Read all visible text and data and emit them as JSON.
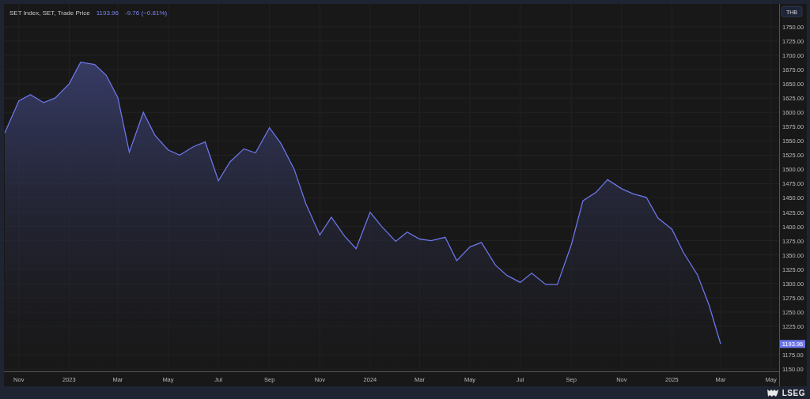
{
  "header": {
    "instrument": "SET Index, SET, Trade Price",
    "last": "1193.96",
    "change": "-9.76 (−0.81%)"
  },
  "price_axis": {
    "currency": "THB",
    "last_price_tag": "1193.96"
  },
  "chart_data": {
    "type": "area",
    "grid": true,
    "x": [
      "2022-10-15",
      "2022-11-01",
      "2022-11-15",
      "2022-12-01",
      "2022-12-15",
      "2023-01-01",
      "2023-01-15",
      "2023-02-01",
      "2023-02-15",
      "2023-03-01",
      "2023-03-15",
      "2023-04-01",
      "2023-04-15",
      "2023-05-01",
      "2023-05-15",
      "2023-06-01",
      "2023-06-15",
      "2023-07-01",
      "2023-07-15",
      "2023-08-01",
      "2023-08-15",
      "2023-09-01",
      "2023-09-15",
      "2023-10-01",
      "2023-10-15",
      "2023-11-01",
      "2023-11-15",
      "2023-12-01",
      "2023-12-15",
      "2024-01-01",
      "2024-01-15",
      "2024-02-01",
      "2024-02-15",
      "2024-03-01",
      "2024-03-15",
      "2024-04-01",
      "2024-04-15",
      "2024-05-01",
      "2024-05-15",
      "2024-06-01",
      "2024-06-15",
      "2024-07-01",
      "2024-07-15",
      "2024-08-01",
      "2024-08-15",
      "2024-09-01",
      "2024-09-15",
      "2024-10-01",
      "2024-10-15",
      "2024-11-01",
      "2024-11-15",
      "2024-12-01",
      "2024-12-15",
      "2025-01-01",
      "2025-01-15",
      "2025-02-01",
      "2025-02-15",
      "2025-03-01"
    ],
    "series": [
      {
        "color": "#6c75e8",
        "values": [
          1564,
          1620,
          1631,
          1617,
          1625,
          1650,
          1688,
          1684,
          1665,
          1626,
          1530,
          1600,
          1560,
          1534,
          1525,
          1540,
          1548,
          1480,
          1513,
          1536,
          1529,
          1573,
          1545,
          1500,
          1440,
          1385,
          1416,
          1383,
          1361,
          1425,
          1400,
          1374,
          1390,
          1378,
          1375,
          1381,
          1340,
          1364,
          1372,
          1332,
          1314,
          1302,
          1318,
          1298,
          1298,
          1368,
          1445,
          1460,
          1482,
          1466,
          1457,
          1451,
          1415,
          1395,
          1354,
          1315,
          1262,
          1194
        ]
      }
    ],
    "xlim": [
      "2022-10-14",
      "2025-05-11"
    ],
    "ylim": [
      1146,
      1790
    ],
    "yticks": [
      {
        "value": 1150,
        "label": "1150.00"
      },
      {
        "value": 1175,
        "label": "1175.00"
      },
      {
        "value": 1225,
        "label": "1225.00"
      },
      {
        "value": 1250,
        "label": "1250.00"
      },
      {
        "value": 1275,
        "label": "1275.00"
      },
      {
        "value": 1300,
        "label": "1300.00"
      },
      {
        "value": 1325,
        "label": "1325.00"
      },
      {
        "value": 1350,
        "label": "1350.00"
      },
      {
        "value": 1375,
        "label": "1375.00"
      },
      {
        "value": 1400,
        "label": "1400.00"
      },
      {
        "value": 1425,
        "label": "1425.00"
      },
      {
        "value": 1450,
        "label": "1450.00"
      },
      {
        "value": 1475,
        "label": "1475.00"
      },
      {
        "value": 1500,
        "label": "1500.00"
      },
      {
        "value": 1525,
        "label": "1525.00"
      },
      {
        "value": 1550,
        "label": "1550.00"
      },
      {
        "value": 1575,
        "label": "1575.00"
      },
      {
        "value": 1600,
        "label": "1600.00"
      },
      {
        "value": 1625,
        "label": "1625.00"
      },
      {
        "value": 1650,
        "label": "1650.00"
      },
      {
        "value": 1675,
        "label": "1675.00"
      },
      {
        "value": 1700,
        "label": "1700.00"
      },
      {
        "value": 1725,
        "label": "1725.00"
      },
      {
        "value": 1750,
        "label": "1750.00"
      }
    ],
    "xticks": [
      {
        "value": "2022-11-01",
        "label": "Nov"
      },
      {
        "value": "2023-01-01",
        "label": "2023"
      },
      {
        "value": "2023-03-01",
        "label": "Mar"
      },
      {
        "value": "2023-05-01",
        "label": "May"
      },
      {
        "value": "2023-07-01",
        "label": "Jul"
      },
      {
        "value": "2023-09-01",
        "label": "Sep"
      },
      {
        "value": "2023-11-01",
        "label": "Nov"
      },
      {
        "value": "2024-01-01",
        "label": "2024"
      },
      {
        "value": "2024-03-01",
        "label": "Mar"
      },
      {
        "value": "2024-05-01",
        "label": "May"
      },
      {
        "value": "2024-07-01",
        "label": "Jul"
      },
      {
        "value": "2024-09-01",
        "label": "Sep"
      },
      {
        "value": "2024-11-01",
        "label": "Nov"
      },
      {
        "value": "2025-01-01",
        "label": "2025"
      },
      {
        "value": "2025-03-01",
        "label": "Mar"
      },
      {
        "value": "2025-05-01",
        "label": "May"
      }
    ]
  },
  "footer": {
    "brand": "LSEG"
  }
}
